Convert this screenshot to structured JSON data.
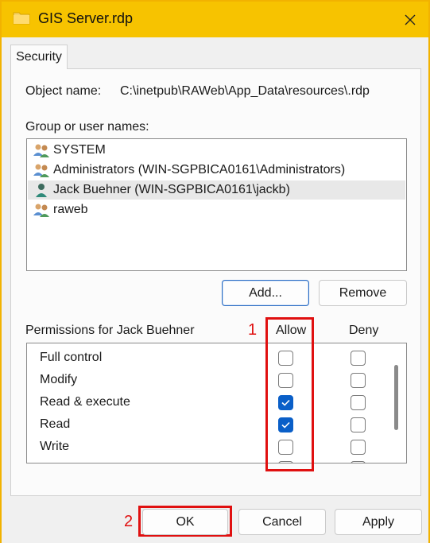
{
  "window": {
    "title": "GIS Server.rdp",
    "close_icon": "close-icon",
    "title_icon": "folder-icon",
    "accent_color": "#f7c300"
  },
  "tabs": [
    {
      "label": "Security",
      "selected": true
    }
  ],
  "object": {
    "label": "Object name:",
    "value": "C:\\inetpub\\RAWeb\\App_Data\\resources\\.rdp"
  },
  "group_list": {
    "label": "Group or user names:",
    "items": [
      {
        "name": "SYSTEM",
        "icon": "user-group-icon",
        "selected": false
      },
      {
        "name": "Administrators (WIN-SGPBICA0161\\Administrators)",
        "icon": "user-group-icon",
        "selected": false
      },
      {
        "name": "Jack Buehner (WIN-SGPBICA0161\\jackb)",
        "icon": "user-icon",
        "selected": true
      },
      {
        "name": "raweb",
        "icon": "user-group-icon",
        "selected": false
      }
    ]
  },
  "list_buttons": {
    "add": "Add...",
    "remove": "Remove"
  },
  "permissions": {
    "label": "Permissions for Jack Buehner",
    "allow_header": "Allow",
    "deny_header": "Deny",
    "rows": [
      {
        "name": "Full control",
        "allow": false,
        "deny": false
      },
      {
        "name": "Modify",
        "allow": false,
        "deny": false
      },
      {
        "name": "Read & execute",
        "allow": true,
        "deny": false
      },
      {
        "name": "Read",
        "allow": true,
        "deny": false
      },
      {
        "name": "Write",
        "allow": false,
        "deny": false
      }
    ]
  },
  "annotations": {
    "marker_1": "1",
    "marker_2": "2",
    "color": "#e01010"
  },
  "dialog_buttons": {
    "ok": "OK",
    "cancel": "Cancel",
    "apply": "Apply"
  }
}
